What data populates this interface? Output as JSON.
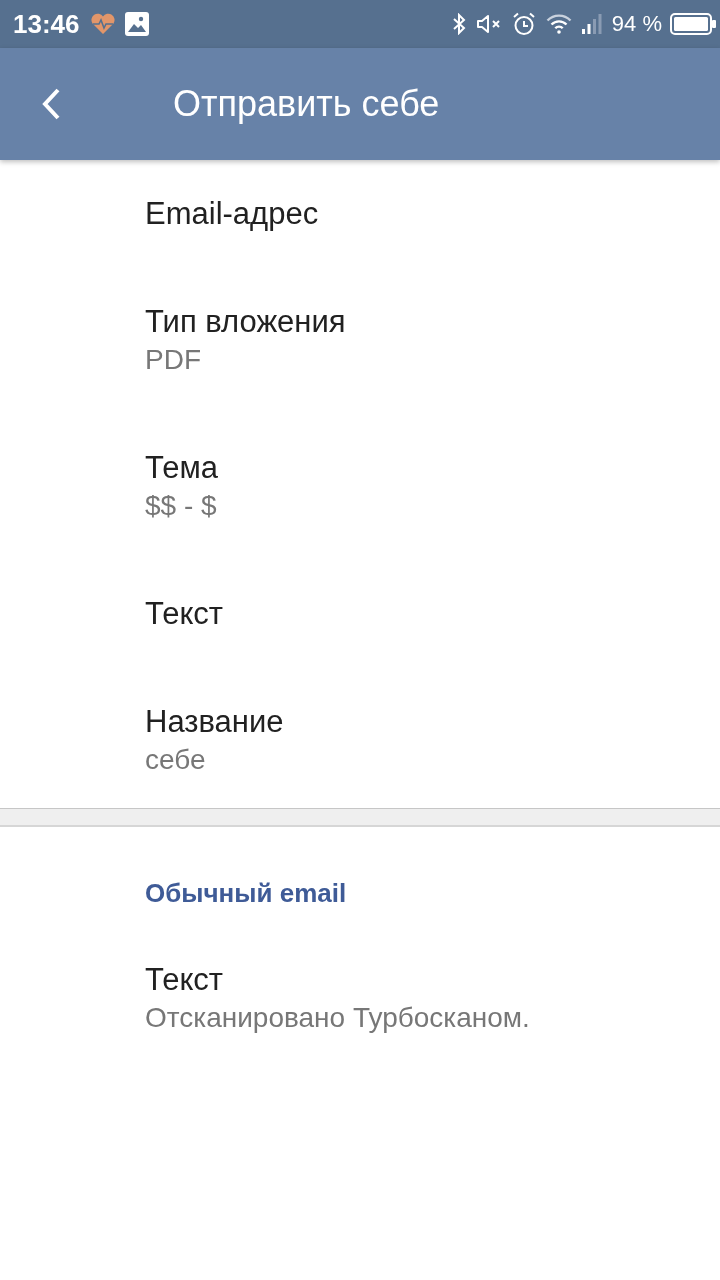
{
  "status_bar": {
    "time": "13:46",
    "battery_text": "94 %"
  },
  "app_bar": {
    "title": "Отправить себе"
  },
  "groups": [
    {
      "items": [
        {
          "title": "Email-адрес"
        },
        {
          "title": "Тип вложения",
          "summary": "PDF"
        },
        {
          "title": "Тема",
          "summary": "$$ - $"
        },
        {
          "title": "Текст"
        },
        {
          "title": "Название",
          "summary": "себе"
        }
      ]
    },
    {
      "header": "Обычный email",
      "items": [
        {
          "title": "Текст",
          "summary": "Отсканировано Турбосканом."
        }
      ]
    }
  ]
}
